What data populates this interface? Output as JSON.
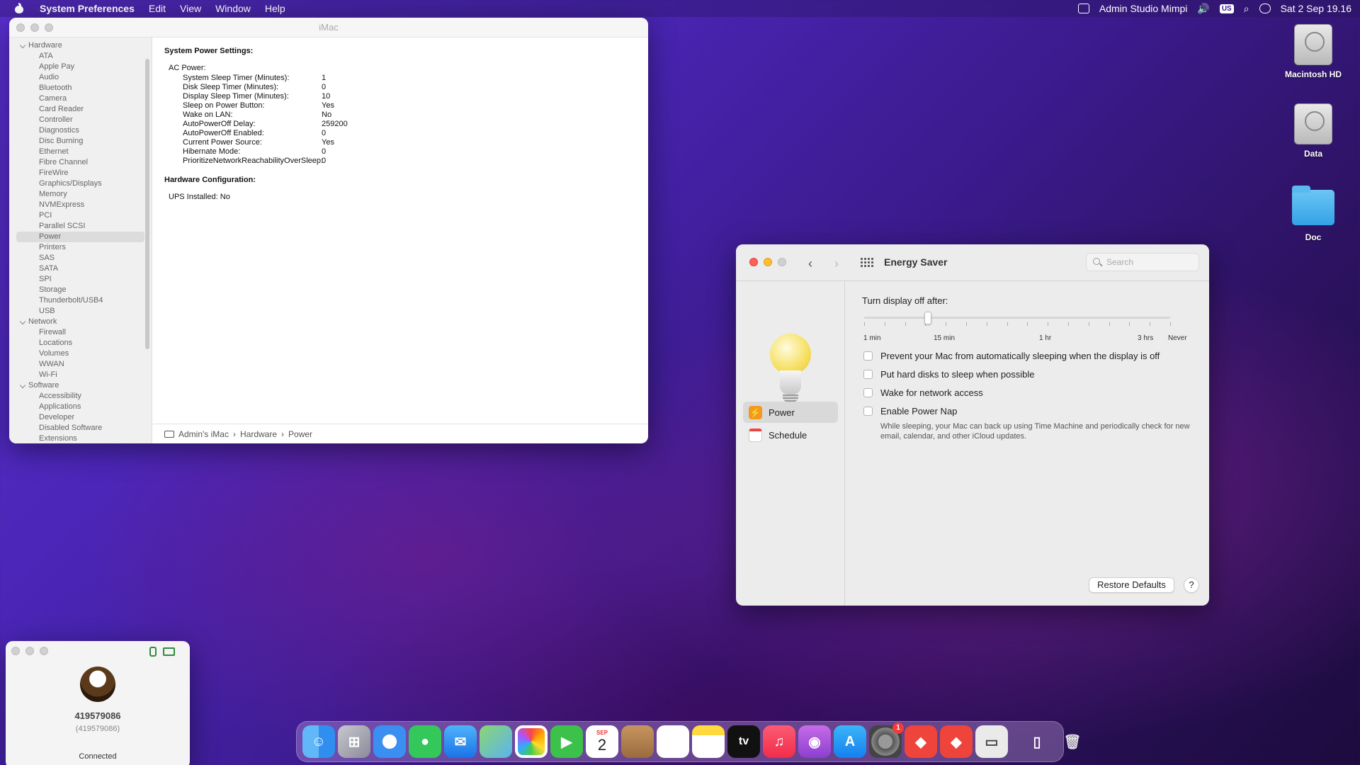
{
  "menubar": {
    "app_name": "System Preferences",
    "menus": [
      "Edit",
      "View",
      "Window",
      "Help"
    ],
    "user": "Admin Studio Mimpi",
    "input_source": "US",
    "datetime": "Sat 2 Sep  19.16"
  },
  "desktop_icons": [
    {
      "label": "Macintosh HD",
      "icon": "hard-drive-icon"
    },
    {
      "label": "Data",
      "icon": "hard-drive-icon"
    },
    {
      "label": "Doc",
      "icon": "folder-icon"
    }
  ],
  "system_info": {
    "window_title": "iMac",
    "sidebar": {
      "hardware": {
        "label": "Hardware",
        "items": [
          "ATA",
          "Apple Pay",
          "Audio",
          "Bluetooth",
          "Camera",
          "Card Reader",
          "Controller",
          "Diagnostics",
          "Disc Burning",
          "Ethernet",
          "Fibre Channel",
          "FireWire",
          "Graphics/Displays",
          "Memory",
          "NVMExpress",
          "PCI",
          "Parallel SCSI",
          "Power",
          "Printers",
          "SAS",
          "SATA",
          "SPI",
          "Storage",
          "Thunderbolt/USB4",
          "USB"
        ]
      },
      "network": {
        "label": "Network",
        "items": [
          "Firewall",
          "Locations",
          "Volumes",
          "WWAN",
          "Wi-Fi"
        ]
      },
      "software": {
        "label": "Software",
        "items": [
          "Accessibility",
          "Applications",
          "Developer",
          "Disabled Software",
          "Extensions"
        ]
      },
      "selected": "Power"
    },
    "content": {
      "power_heading": "System Power Settings:",
      "ac_label": "AC Power:",
      "ac_settings": [
        {
          "key": "System Sleep Timer (Minutes):",
          "value": "1"
        },
        {
          "key": "Disk Sleep Timer (Minutes):",
          "value": "0"
        },
        {
          "key": "Display Sleep Timer (Minutes):",
          "value": "10"
        },
        {
          "key": "Sleep on Power Button:",
          "value": "Yes"
        },
        {
          "key": "Wake on LAN:",
          "value": "No"
        },
        {
          "key": "AutoPowerOff Delay:",
          "value": "259200"
        },
        {
          "key": "AutoPowerOff Enabled:",
          "value": "0"
        },
        {
          "key": "Current Power Source:",
          "value": "Yes"
        },
        {
          "key": "Hibernate Mode:",
          "value": "0"
        },
        {
          "key": "PrioritizeNetworkReachabilityOverSleep:",
          "value": "0"
        }
      ],
      "hw_heading": "Hardware Configuration:",
      "ups": "UPS Installed:  No"
    },
    "path": {
      "computer": "Admin's iMac",
      "sep": "›",
      "section": "Hardware",
      "item": "Power"
    }
  },
  "energy_saver": {
    "title": "Energy Saver",
    "search_placeholder": "Search",
    "side_items": [
      {
        "label": "Power",
        "icon": "lightning-icon",
        "color": "#f29a1f"
      },
      {
        "label": "Schedule",
        "icon": "calendar-icon",
        "color": "#ffffff"
      }
    ],
    "slider": {
      "label": "Turn display off after:",
      "tick_labels": [
        "1 min",
        "15 min",
        "1 hr",
        "3 hrs",
        "Never"
      ],
      "value_minutes": 10
    },
    "options": [
      {
        "label": "Prevent your Mac from automatically sleeping when the display is off",
        "checked": false
      },
      {
        "label": "Put hard disks to sleep when possible",
        "checked": false
      },
      {
        "label": "Wake for network access",
        "checked": false
      },
      {
        "label": "Enable Power Nap",
        "checked": false
      }
    ],
    "power_nap_note": "While sleeping, your Mac can back up using Time Machine and periodically check for new email, calendar, and other iCloud updates.",
    "restore_label": "Restore Defaults",
    "help_label": "?"
  },
  "connection": {
    "id": "419579086",
    "id_paren": "(419579086)",
    "status": "Connected"
  },
  "dock": {
    "calendar_month": "SEP",
    "calendar_day": "2",
    "sysprefs_badge": "1",
    "tv_label": "tv",
    "apps": [
      "finder",
      "launchpad",
      "safari",
      "messages",
      "mail",
      "maps",
      "photos",
      "facetime",
      "calendar",
      "contacts",
      "reminders",
      "notes",
      "tv",
      "music",
      "podcasts",
      "app-store",
      "system-preferences",
      "anydesk",
      "anydesk-2",
      "scanner",
      "file",
      "trash"
    ]
  }
}
